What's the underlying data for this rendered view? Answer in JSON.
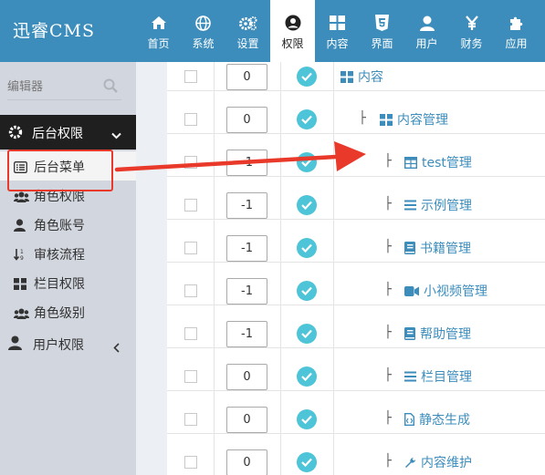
{
  "app": {
    "logo": "迅睿CMS"
  },
  "topnav": [
    {
      "label": "首页",
      "icon": "home-icon"
    },
    {
      "label": "系统",
      "icon": "globe-icon"
    },
    {
      "label": "设置",
      "icon": "gears-icon"
    },
    {
      "label": "权限",
      "icon": "user-circle-icon",
      "active": true
    },
    {
      "label": "内容",
      "icon": "grid-icon"
    },
    {
      "label": "界面",
      "icon": "html5-icon"
    },
    {
      "label": "用户",
      "icon": "user-icon"
    },
    {
      "label": "财务",
      "icon": "yen-icon"
    },
    {
      "label": "应用",
      "icon": "puzzle-icon"
    }
  ],
  "sidebar": {
    "search_text": "编辑器",
    "section": "后台权限",
    "items": [
      {
        "label": "后台菜单",
        "icon": "list-icon",
        "active": true
      },
      {
        "label": "角色权限",
        "icon": "users-icon"
      },
      {
        "label": "角色账号",
        "icon": "user-icon"
      },
      {
        "label": "审核流程",
        "icon": "sort-icon"
      },
      {
        "label": "栏目权限",
        "icon": "grid-icon"
      },
      {
        "label": "角色级别",
        "icon": "users-icon"
      }
    ],
    "user_perm": "用户权限"
  },
  "rows": [
    {
      "order": "0",
      "prefix": "",
      "name": "内容",
      "icon": "grid-icon"
    },
    {
      "order": "0",
      "prefix": "├",
      "name": "内容管理",
      "icon": "grid-icon"
    },
    {
      "order": "-1",
      "prefix": "├",
      "name": "test管理",
      "icon": "table-icon"
    },
    {
      "order": "-1",
      "prefix": "├",
      "name": "示例管理",
      "icon": "bars-icon"
    },
    {
      "order": "-1",
      "prefix": "├",
      "name": "书籍管理",
      "icon": "book-icon"
    },
    {
      "order": "-1",
      "prefix": "├",
      "name": "小视频管理",
      "icon": "video-icon"
    },
    {
      "order": "-1",
      "prefix": "├",
      "name": "帮助管理",
      "icon": "book-icon"
    },
    {
      "order": "0",
      "prefix": "├",
      "name": "栏目管理",
      "icon": "bars-icon"
    },
    {
      "order": "0",
      "prefix": "├",
      "name": "静态生成",
      "icon": "file-icon"
    },
    {
      "order": "0",
      "prefix": "├",
      "name": "内容维护",
      "icon": "wrench-icon"
    }
  ],
  "colors": {
    "accent": "#3c8dbc",
    "tick": "#4dc4d7",
    "highlight": "#e8392a"
  }
}
